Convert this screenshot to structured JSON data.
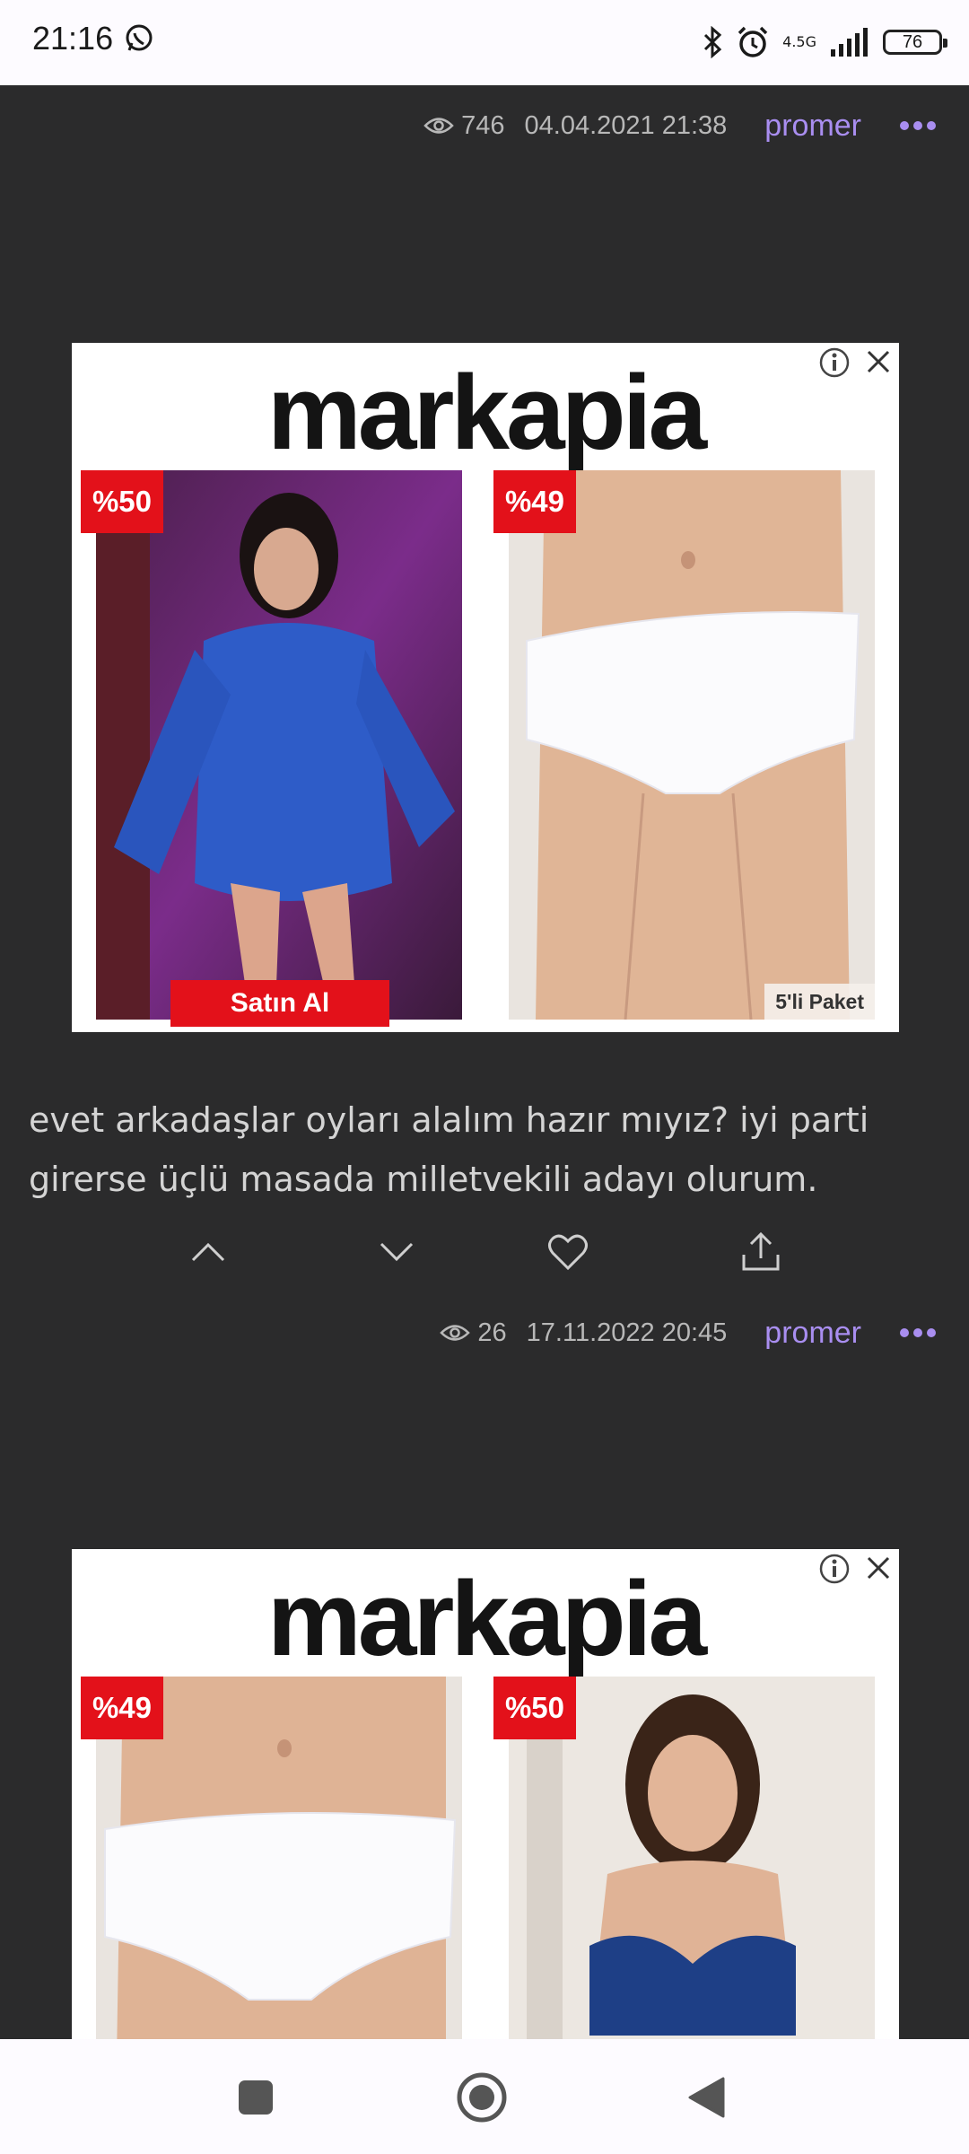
{
  "status_bar": {
    "time": "21:16",
    "network": "4.5G",
    "battery": "76",
    "icons": [
      "whatsapp-icon",
      "bluetooth-icon",
      "alarm-icon",
      "signal-icon",
      "battery-icon"
    ]
  },
  "posts": [
    {
      "views": "746",
      "date": "04.04.2021 21:38",
      "author": "promer"
    },
    {
      "text": "evet arkadaşlar oyları alalım hazır mıyız? iyi parti girerse üçlü masada milletvekili adayı olurum.",
      "views": "26",
      "date": "17.11.2022 20:45",
      "author": "promer"
    }
  ],
  "ads": [
    {
      "brand": "markapia",
      "left_badge": "%50",
      "right_badge": "%49",
      "buy_label": "Satın Al",
      "pack_label": "5'li Paket"
    },
    {
      "brand": "markapia",
      "left_badge": "%49",
      "right_badge": "%50"
    }
  ],
  "colors": {
    "background": "#2b2b2c",
    "author": "#a98ef0",
    "badge": "#e3111a"
  }
}
